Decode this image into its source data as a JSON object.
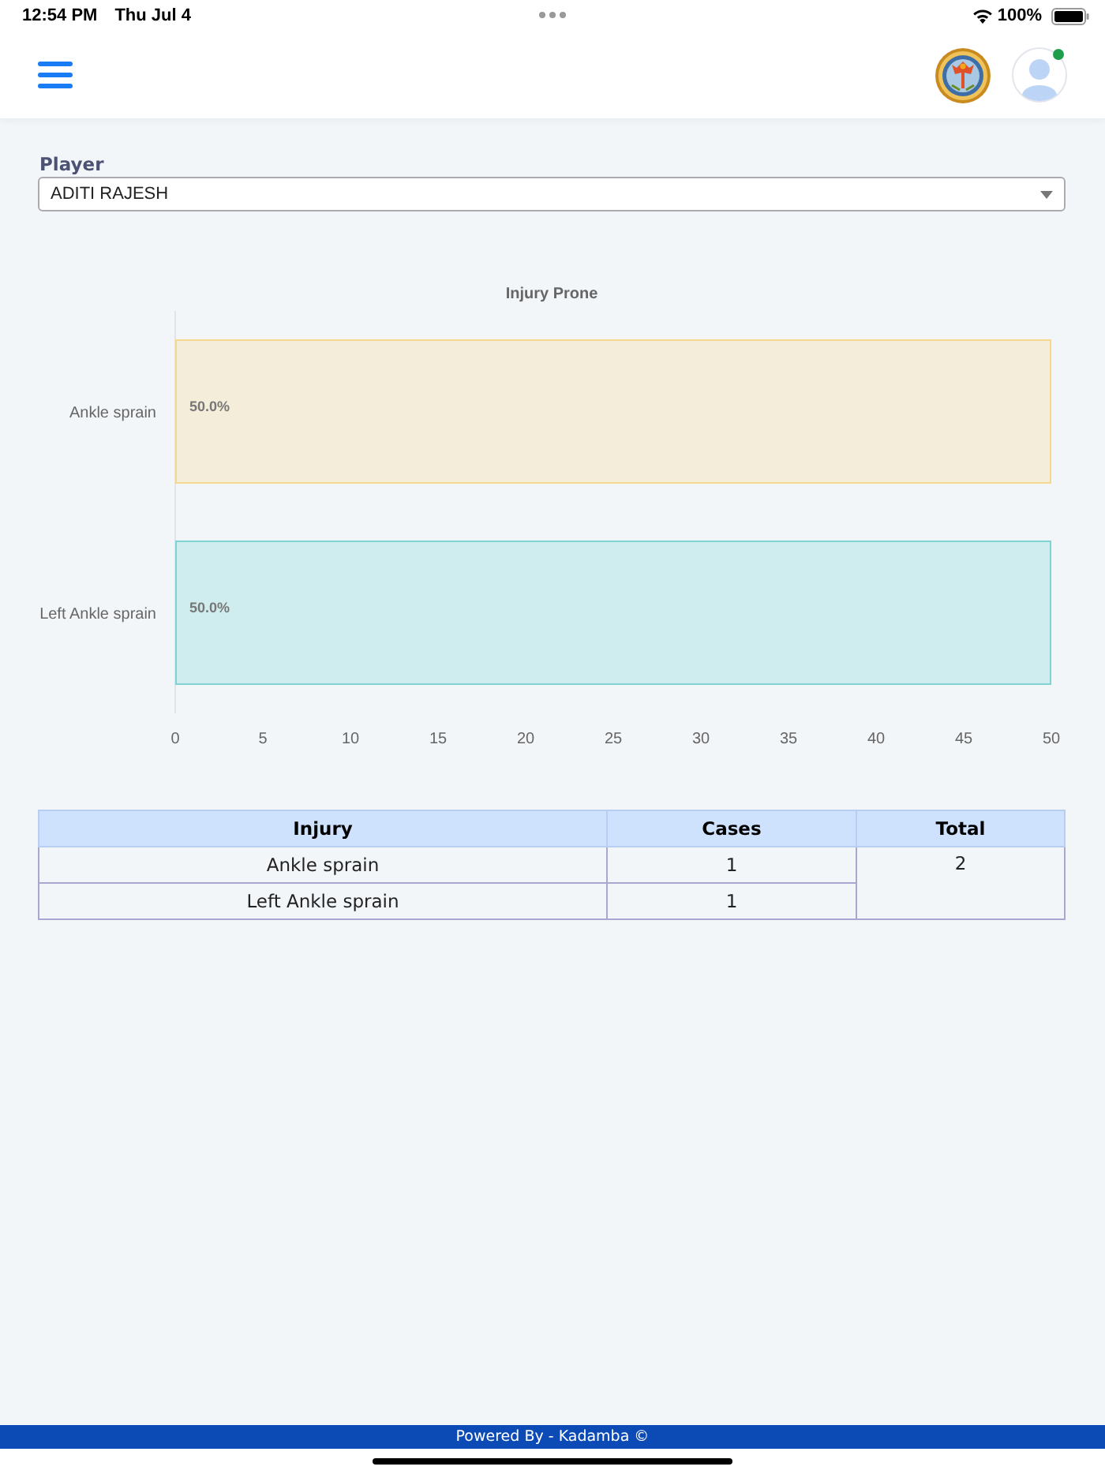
{
  "status_bar": {
    "time": "12:54 PM",
    "date": "Thu Jul 4",
    "battery": "100%"
  },
  "header": {
    "avatar": {
      "online": true
    }
  },
  "player_field": {
    "label": "Player",
    "value": "ADITI RAJESH"
  },
  "chart": {
    "chart_data": {
      "type": "bar",
      "orientation": "horizontal",
      "title": "Injury Prone",
      "categories": [
        "Ankle sprain",
        "Left Ankle sprain"
      ],
      "series": [
        {
          "color": "#f5d88f",
          "values": [
            50,
            null
          ]
        },
        {
          "color": "#7fd3d3",
          "values": [
            null,
            50
          ]
        }
      ],
      "stacked": true,
      "xlim": [
        0,
        50
      ],
      "xticks": [
        0,
        5,
        10,
        15,
        20,
        25,
        30,
        35,
        40,
        45,
        50
      ],
      "value_labels": [
        "50.0%",
        "50.0%"
      ]
    }
  },
  "table": {
    "columns": [
      "Injury",
      "Cases",
      "Total"
    ],
    "rows": [
      {
        "injury": "Ankle sprain",
        "cases": "1"
      },
      {
        "injury": "Left Ankle sprain",
        "cases": "1"
      }
    ],
    "total": "2"
  },
  "footer": {
    "text": "Powered By - Kadamba ©"
  }
}
